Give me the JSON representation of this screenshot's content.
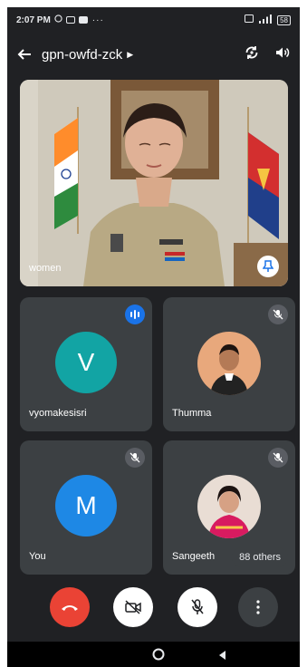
{
  "status_bar": {
    "time": "2:07 PM",
    "dots": "···",
    "battery": "58"
  },
  "meeting": {
    "code": "gpn-owfd-zck"
  },
  "main_tile": {
    "name": "women"
  },
  "participants": [
    {
      "name": "vyomakesisri",
      "initial": "V",
      "avatar_color": "#12a4a4",
      "state": "speaking"
    },
    {
      "name": "Thumma",
      "state": "muted"
    },
    {
      "name": "You",
      "initial": "M",
      "avatar_color": "#1e88e5",
      "state": "muted"
    },
    {
      "name": "Sangeeth",
      "state": "muted"
    }
  ],
  "others_count": "88 others",
  "colors": {
    "background": "#202124",
    "tile": "#3c4043",
    "end_call": "#ea4335",
    "accent": "#1a73e8"
  }
}
